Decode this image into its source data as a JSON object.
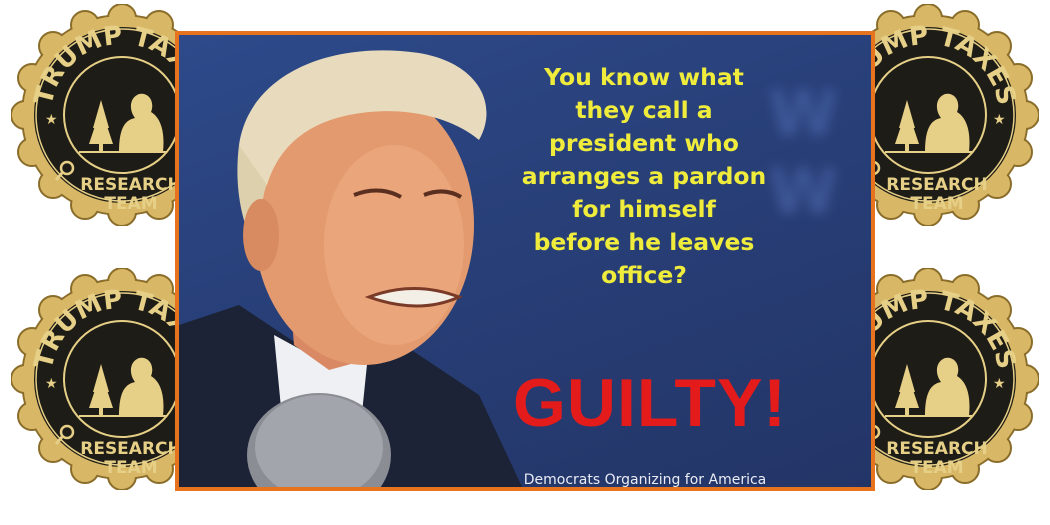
{
  "badge": {
    "top_text": "TRUMP TAXES",
    "bottom_line1": "RESEARCH",
    "bottom_line2": "TEAM"
  },
  "meme": {
    "question_lines": [
      "You know what",
      "they call a",
      "president who",
      "arranges a pardon",
      "for himself",
      "before he leaves",
      "office?"
    ],
    "answer": "GUILTY!",
    "credit": "Democrats Organizing for America",
    "colors": {
      "frame": "#e8731f",
      "background": "#283f78",
      "question_text": "#f0ec3c",
      "answer_text": "#e31b1b"
    }
  }
}
